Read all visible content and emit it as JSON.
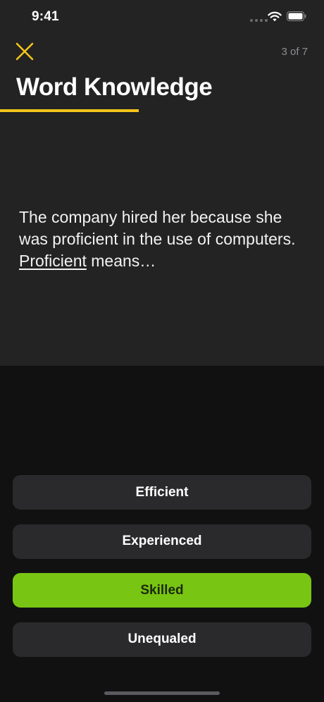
{
  "status_bar": {
    "time": "9:41",
    "icons": [
      "cellular-signal-icon",
      "wifi-icon",
      "battery-icon"
    ]
  },
  "header": {
    "close_icon": "close-icon",
    "progress": "3 of 7",
    "title": "Word Knowledge"
  },
  "question": {
    "text_before": "The company hired her because she was proficient in the use of computers. ",
    "keyword": "Proficient",
    "text_after": " means…"
  },
  "answers": [
    {
      "label": "Efficient",
      "selected": false
    },
    {
      "label": "Experienced",
      "selected": false
    },
    {
      "label": "Skilled",
      "selected": true
    },
    {
      "label": "Unequaled",
      "selected": false
    }
  ],
  "colors": {
    "accent": "#f5c518",
    "selected": "#78c514",
    "panel": "#232324",
    "background": "#111112",
    "button": "#2a2a2c"
  }
}
